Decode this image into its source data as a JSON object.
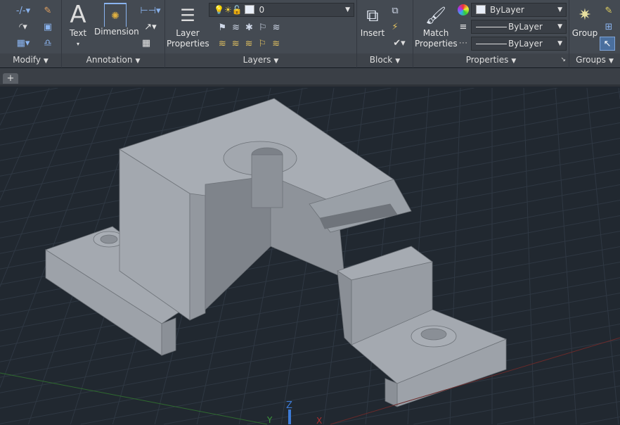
{
  "ribbon": {
    "modify": {
      "label": "Modify"
    },
    "annotation": {
      "label": "Annotation",
      "text": "Text",
      "dimension": "Dimension"
    },
    "layers": {
      "label": "Layers",
      "layer_properties": "Layer Properties",
      "current_layer": "0"
    },
    "block": {
      "label": "Block",
      "insert": "Insert"
    },
    "properties": {
      "label": "Properties",
      "match_properties": "Match Properties",
      "color": "ByLayer",
      "linetype": "ByLayer",
      "lineweight": "ByLayer"
    },
    "groups": {
      "label": "Groups",
      "group": "Group"
    }
  },
  "tabs": {
    "new_tab": "+"
  },
  "viewport": {
    "ucs": {
      "z": "Z",
      "y": "Y",
      "x": "X"
    }
  },
  "colors": {
    "background": "#212830",
    "model": "#9ea3aa",
    "accent": "#3d7bd6"
  }
}
